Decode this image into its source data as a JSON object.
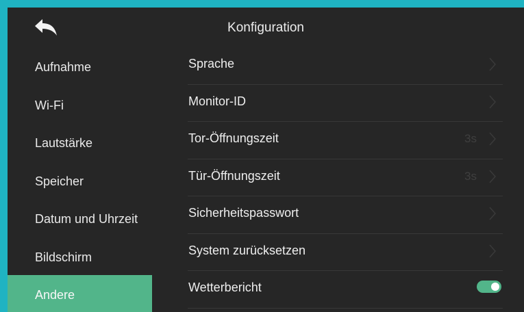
{
  "header": {
    "title": "Konfiguration",
    "back_icon": "back-arrow-icon"
  },
  "sidebar": {
    "items": [
      {
        "label": "Aufnahme",
        "active": false
      },
      {
        "label": "Wi-Fi",
        "active": false
      },
      {
        "label": "Lautstärke",
        "active": false
      },
      {
        "label": "Speicher",
        "active": false
      },
      {
        "label": "Datum und Uhrzeit",
        "active": false
      },
      {
        "label": "Bildschirm",
        "active": false
      },
      {
        "label": "Andere",
        "active": true
      }
    ]
  },
  "settings": {
    "rows": [
      {
        "label": "Sprache",
        "value": "",
        "control": "chevron-right-icon"
      },
      {
        "label": "Monitor-ID",
        "value": "",
        "control": "chevron-right-icon"
      },
      {
        "label": "Tor-Öffnungszeit",
        "value": "3s",
        "control": "chevron-right-icon"
      },
      {
        "label": "Tür-Öffnungszeit",
        "value": "3s",
        "control": "chevron-right-icon"
      },
      {
        "label": "Sicherheitspasswort",
        "value": "",
        "control": "chevron-right-icon"
      },
      {
        "label": "System zurücksetzen",
        "value": "",
        "control": "chevron-right-icon"
      },
      {
        "label": "Wetterbericht",
        "value": "",
        "control": "toggle",
        "toggle_on": true
      }
    ]
  },
  "colors": {
    "background": "#262626",
    "frame_border": "#1fb3c2",
    "accent": "#52b58a",
    "text": "#eeeeee",
    "muted": "#3f3f3f"
  }
}
